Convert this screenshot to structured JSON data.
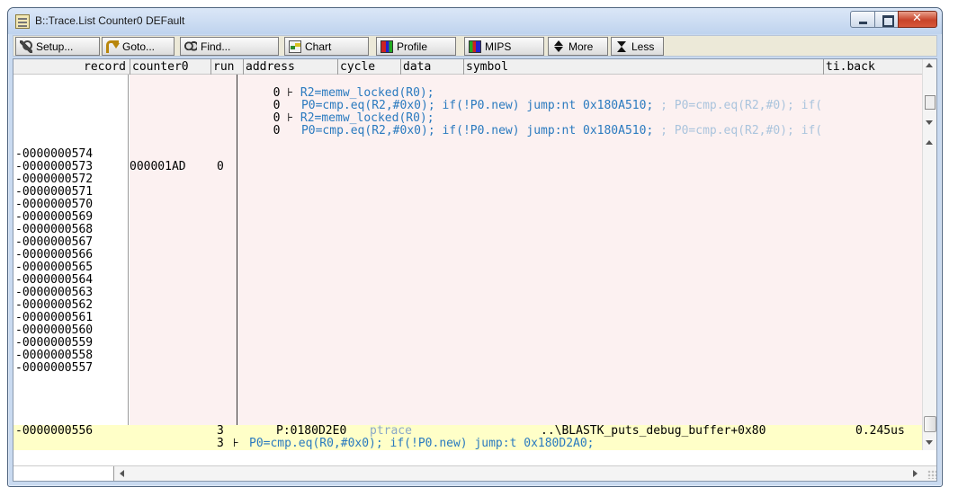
{
  "window": {
    "title": "B::Trace.List Counter0 DEFault"
  },
  "toolbar": {
    "setup": "Setup...",
    "goto": "Goto...",
    "find": "Find...",
    "chart": "Chart",
    "profile": "Profile",
    "mips": "MIPS",
    "more": "More",
    "less": "Less"
  },
  "columns": {
    "record": "record",
    "counter0": "counter0",
    "run": "run",
    "address": "address",
    "cycle": "cycle",
    "data": "data",
    "symbol": "symbol",
    "tiback": "ti.back"
  },
  "top_lines": [
    {
      "run": "0",
      "text": "R2=memw_locked(R0);",
      "comment": ""
    },
    {
      "run": "0",
      "text": "P0=cmp.eq(R2,#0x0); if(!P0.new) jump:nt 0x180A510;",
      "comment": " ; P0=cmp.eq(R2,#0); if("
    },
    {
      "run": "0",
      "text": "R2=memw_locked(R0);",
      "comment": ""
    },
    {
      "run": "0",
      "text": "P0=cmp.eq(R2,#0x0); if(!P0.new) jump:nt 0x180A510;",
      "comment": " ; P0=cmp.eq(R2,#0); if("
    }
  ],
  "records": [
    "-0000000574",
    "-0000000573",
    "-0000000572",
    "-0000000571",
    "-0000000570",
    "-0000000569",
    "-0000000568",
    "-0000000567",
    "-0000000566",
    "-0000000565",
    "-0000000564",
    "-0000000563",
    "-0000000562",
    "-0000000561",
    "-0000000560",
    "-0000000559",
    "-0000000558",
    "-0000000557"
  ],
  "row573": {
    "counter0": "000001AD",
    "run": "0"
  },
  "highlight": {
    "record": "-0000000556",
    "run": "3",
    "address": "P:0180D2E0",
    "cycle": "ptrace",
    "symbol": "..\\BLASTK_puts_debug_buffer+0x80",
    "tiback": "0.245us",
    "run2": "3",
    "instr": "P0=cmp.eq(R0,#0x0); if(!P0.new) jump:t 0x180D2A0;"
  },
  "colors": {
    "instruction": "#2a7abf",
    "comment": "#aac4dd",
    "highlight": "#ffffc8",
    "trace_bg": "#fcf1f1"
  }
}
